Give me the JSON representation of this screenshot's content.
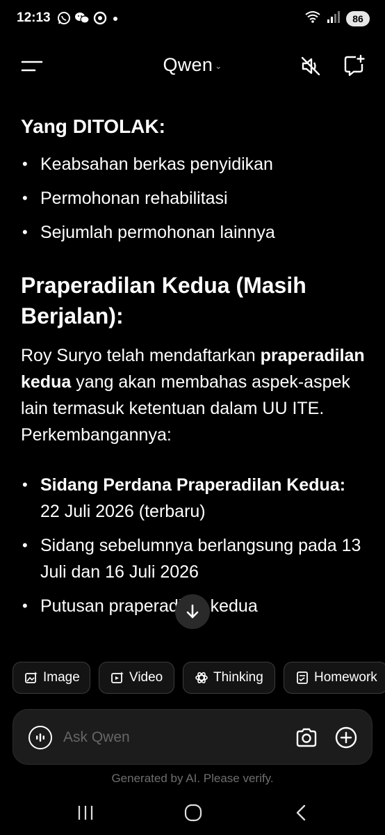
{
  "status_bar": {
    "time": "12:13",
    "battery": "86",
    "icons": [
      "whatsapp-icon",
      "wechat-icon",
      "app-icon",
      "dot-icon",
      "wifi-icon",
      "signal-icon",
      "battery-icon"
    ]
  },
  "header": {
    "title": "Qwen",
    "icons": [
      "menu-icon",
      "chevron-down-icon",
      "mute-icon",
      "new-chat-icon"
    ]
  },
  "message": {
    "heading_ditolak": "Yang DITOLAK:",
    "ditolak_items": [
      "Keabsahan berkas penyidikan",
      "Permohonan rehabilitasi",
      "Sejumlah permohonan lainnya"
    ],
    "heading_kedua": "Praperadilan Kedua (Masih Berjalan):",
    "para": {
      "p1": "Roy Suryo telah mendaftarkan ",
      "bold": "praperadilan kedua",
      "p2": " yang akan membahas aspek-aspek lain termasuk ketentuan dalam UU ITE. Perkembangannya:"
    },
    "kedua_items": [
      {
        "bold": "Sidang Perdana Praperadilan Kedua:",
        "text": " 22 Juli 2026 (terbaru)"
      },
      {
        "bold": "",
        "text": "Sidang sebelumnya berlangsung pada 13 Juli dan 16 Juli 2026"
      },
      {
        "bold": "",
        "text": "Putusan praperadilan kedua"
      }
    ]
  },
  "chips": [
    {
      "label": "Image",
      "icon": "image-icon"
    },
    {
      "label": "Video",
      "icon": "video-icon"
    },
    {
      "label": "Thinking",
      "icon": "thinking-icon"
    },
    {
      "label": "Homework",
      "icon": "homework-icon"
    }
  ],
  "input": {
    "placeholder": "Ask Qwen"
  },
  "disclaimer": "Generated by AI. Please verify."
}
